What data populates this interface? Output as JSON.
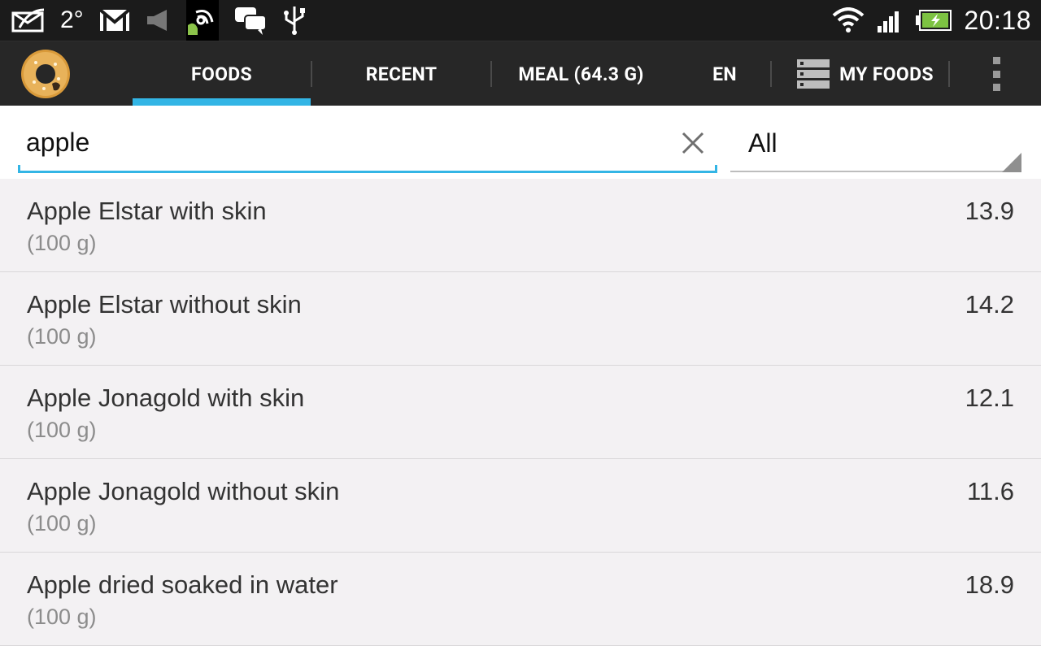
{
  "status_bar": {
    "temperature": "2°",
    "time": "20:18",
    "icons": [
      "notification-envelope-icon",
      "gmail-icon",
      "volume-muted-icon",
      "android-nfc-icon",
      "chat-bubbles-icon",
      "usb-icon",
      "wifi-icon",
      "signal-icon",
      "battery-charging-icon"
    ]
  },
  "action_bar": {
    "tabs": [
      {
        "label": "FOODS",
        "selected": true
      },
      {
        "label": "RECENT",
        "selected": false
      },
      {
        "label": "MEAL (64.3 G)",
        "selected": false
      },
      {
        "label": "EN",
        "selected": false
      },
      {
        "label": "MY FOODS",
        "selected": false
      }
    ],
    "accent_color": "#33b5e5"
  },
  "search": {
    "value": "apple",
    "filter_value": "All"
  },
  "foods": [
    {
      "name": "Apple Elstar with skin",
      "portion": "(100 g)",
      "value": "13.9"
    },
    {
      "name": "Apple Elstar without skin",
      "portion": "(100 g)",
      "value": "14.2"
    },
    {
      "name": "Apple Jonagold with skin",
      "portion": "(100 g)",
      "value": "12.1"
    },
    {
      "name": "Apple Jonagold without skin",
      "portion": "(100 g)",
      "value": "11.6"
    },
    {
      "name": "Apple dried soaked in water",
      "portion": "(100 g)",
      "value": "18.9"
    }
  ]
}
